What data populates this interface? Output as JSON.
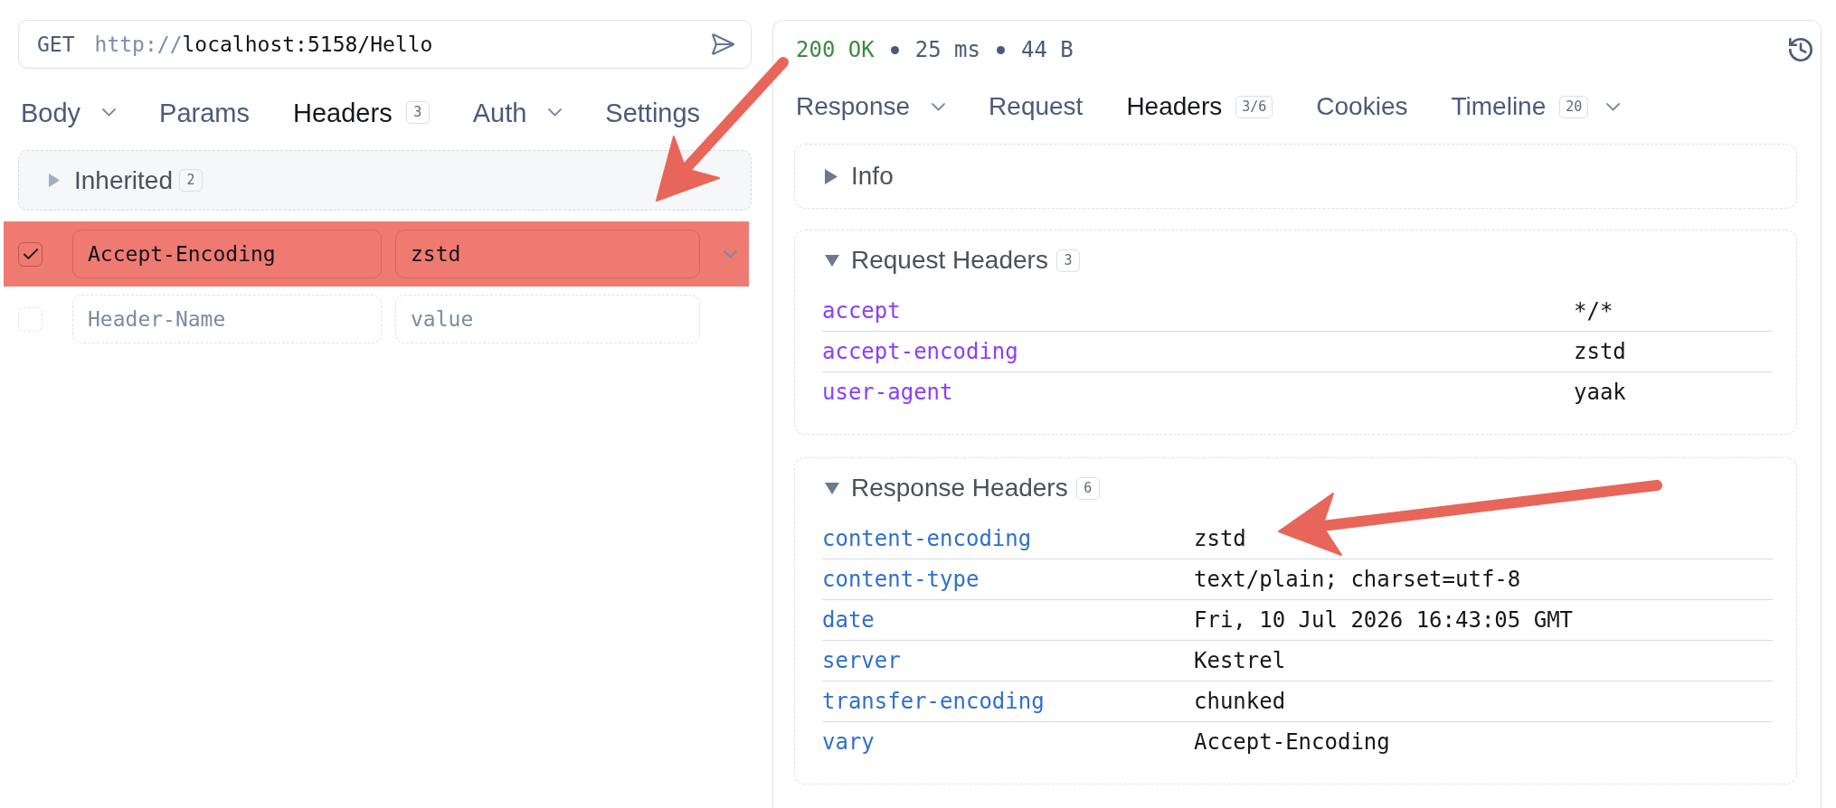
{
  "request": {
    "method": "GET",
    "url": {
      "scheme": "http://",
      "address": "localhost:5158/Hello"
    }
  },
  "request_tabs": [
    {
      "label": "Body",
      "selected": false,
      "dropdown": true
    },
    {
      "label": "Params",
      "selected": false,
      "dropdown": false
    },
    {
      "label": "Headers",
      "selected": true,
      "dropdown": false,
      "count": "3"
    },
    {
      "label": "Auth",
      "selected": false,
      "dropdown": true
    },
    {
      "label": "Settings",
      "selected": false,
      "dropdown": false
    }
  ],
  "inherited": {
    "label": "Inherited",
    "count": "2",
    "expanded": false
  },
  "header_rows": [
    {
      "kind": "entry",
      "checked": true,
      "highlighted": true,
      "dropdown": true,
      "name": {
        "value": "Accept-Encoding"
      },
      "value": {
        "value": "zstd"
      }
    },
    {
      "kind": "draft",
      "checked": false,
      "highlighted": false,
      "dropdown": false,
      "name": {
        "placeholder": "Header-Name"
      },
      "value": {
        "placeholder": "value"
      }
    }
  ],
  "response": {
    "status": "200 OK",
    "time": "25 ms",
    "size": "44 B"
  },
  "response_tabs": [
    {
      "label": "Response",
      "selected": false,
      "dropdown": true
    },
    {
      "label": "Request",
      "selected": false,
      "dropdown": false
    },
    {
      "label": "Headers",
      "selected": true,
      "dropdown": false,
      "count": "3/6"
    },
    {
      "label": "Cookies",
      "selected": false,
      "dropdown": false
    },
    {
      "label": "Timeline",
      "selected": false,
      "dropdown": true,
      "count": "20"
    }
  ],
  "sections": [
    {
      "kind": "info",
      "title": "Info",
      "expanded": false
    },
    {
      "kind": "request",
      "title": "Request Headers",
      "count": "3",
      "expanded": true,
      "rows": [
        {
          "name": "accept",
          "value": "*/*"
        },
        {
          "name": "accept-encoding",
          "value": "zstd"
        },
        {
          "name": "user-agent",
          "value": "yaak"
        }
      ]
    },
    {
      "kind": "response",
      "title": "Response Headers",
      "count": "6",
      "expanded": true,
      "rows": [
        {
          "name": "content-encoding",
          "value": "zstd"
        },
        {
          "name": "content-type",
          "value": "text/plain; charset=utf-8"
        },
        {
          "name": "date",
          "value": "Fri, 10 Jul 2026 16:43:05 GMT"
        },
        {
          "name": "server",
          "value": "Kestrel"
        },
        {
          "name": "transfer-encoding",
          "value": "chunked"
        },
        {
          "name": "vary",
          "value": "Accept-Encoding"
        }
      ]
    }
  ],
  "annotations": [
    {
      "kind": "arrow"
    },
    {
      "kind": "arrow"
    }
  ]
}
